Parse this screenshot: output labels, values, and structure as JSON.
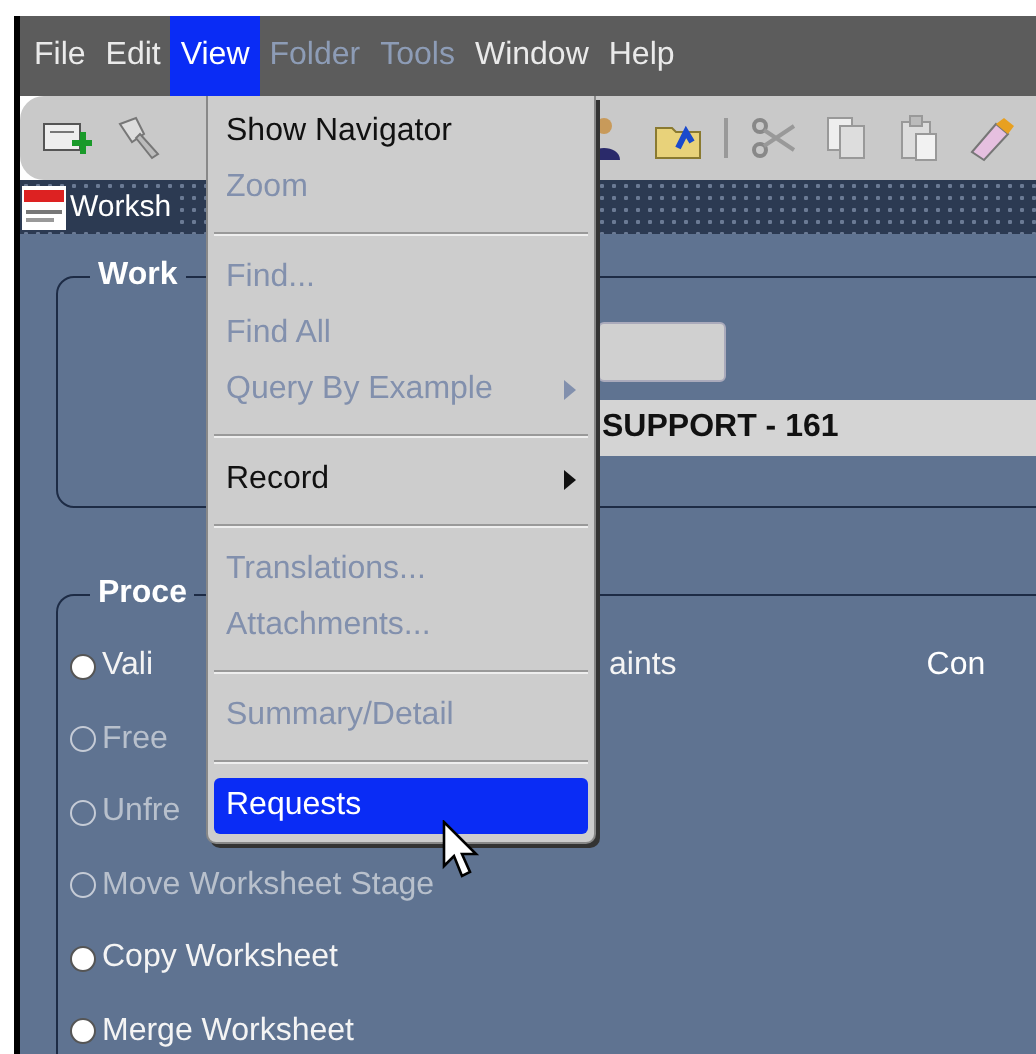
{
  "menubar": [
    {
      "label": "File",
      "selected": false,
      "disabled": false
    },
    {
      "label": "Edit",
      "selected": false,
      "disabled": false
    },
    {
      "label": "View",
      "selected": true,
      "disabled": false
    },
    {
      "label": "Folder",
      "selected": false,
      "disabled": true
    },
    {
      "label": "Tools",
      "selected": false,
      "disabled": true
    },
    {
      "label": "Window",
      "selected": false,
      "disabled": false
    },
    {
      "label": "Help",
      "selected": false,
      "disabled": false
    }
  ],
  "window": {
    "title": "Worksh"
  },
  "worksheet_group": {
    "title": "Work",
    "name_field": {
      "value": "SUPPORT - 161"
    }
  },
  "process_group": {
    "title": "Proce",
    "right_label": "Con",
    "options": [
      {
        "label": "Vali",
        "label_after_menu": "aints",
        "disabled": false
      },
      {
        "label": "Free",
        "disabled": true
      },
      {
        "label": "Unfre",
        "disabled": true
      },
      {
        "label": "Move Worksheet Stage",
        "disabled": true
      },
      {
        "label": "Copy Worksheet",
        "disabled": false
      },
      {
        "label": "Merge Worksheet",
        "disabled": false
      }
    ]
  },
  "view_menu": {
    "items": [
      {
        "kind": "item",
        "label": "Show Navigator",
        "disabled": false,
        "submenu": false,
        "selected": false
      },
      {
        "kind": "item",
        "label": "Zoom",
        "disabled": true,
        "submenu": false,
        "selected": false
      },
      {
        "kind": "separator"
      },
      {
        "kind": "item",
        "label": "Find...",
        "disabled": true,
        "submenu": false,
        "selected": false
      },
      {
        "kind": "item",
        "label": "Find All",
        "disabled": true,
        "submenu": false,
        "selected": false
      },
      {
        "kind": "item",
        "label": "Query By Example",
        "disabled": true,
        "submenu": true,
        "selected": false
      },
      {
        "kind": "separator"
      },
      {
        "kind": "item",
        "label": "Record",
        "disabled": false,
        "submenu": true,
        "selected": false
      },
      {
        "kind": "separator"
      },
      {
        "kind": "item",
        "label": "Translations...",
        "disabled": true,
        "submenu": false,
        "selected": false
      },
      {
        "kind": "item",
        "label": "Attachments...",
        "disabled": true,
        "submenu": false,
        "selected": false
      },
      {
        "kind": "separator"
      },
      {
        "kind": "item",
        "label": "Summary/Detail",
        "disabled": true,
        "submenu": false,
        "selected": false
      },
      {
        "kind": "separator"
      },
      {
        "kind": "item",
        "label": "Requests",
        "disabled": false,
        "submenu": false,
        "selected": true
      }
    ]
  }
}
